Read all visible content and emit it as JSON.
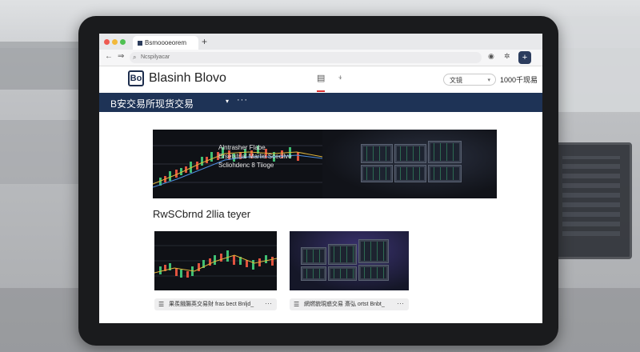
{
  "browser": {
    "tab_title": "Bsmoooeorem",
    "new_tab": "+",
    "back": "←",
    "forward": "⇒",
    "address_placeholder": "Ncspilyacar",
    "ext_label": "+"
  },
  "site": {
    "logo_letters": "Bo",
    "brand": "Blasinh Blovo",
    "language": "文镜",
    "volume": "1000千现易"
  },
  "navbar": {
    "title": "B安交易所现货交易",
    "caret": "▾",
    "more": "···"
  },
  "hero": {
    "lines": [
      "Alntrasher Flabe",
      "Ersetstrial Marlie Scecilve",
      "Scliohdenc 8 Tiioge"
    ]
  },
  "section_title": "RwSCbrnd 2llia teyer",
  "cards": [
    {
      "footer": "果羨餓腸英交易財 fras bect Bnljd_",
      "more": "···"
    },
    {
      "footer": "網燃貌現惑交易 斎弘 ortst Bnbt_",
      "more": "···"
    }
  ],
  "colors": {
    "navy": "#1e3356",
    "chart_green": "#3fbf73",
    "chart_red": "#e0533f"
  }
}
